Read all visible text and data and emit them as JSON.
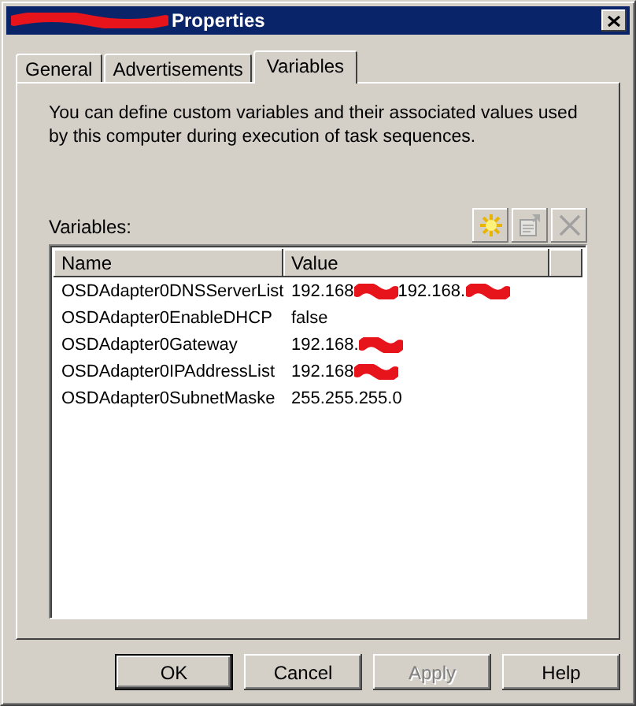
{
  "window": {
    "title": "Properties",
    "title_redacted": true
  },
  "tabs": [
    {
      "label": "General",
      "selected": false
    },
    {
      "label": "Advertisements",
      "selected": false
    },
    {
      "label": "Variables",
      "selected": true
    }
  ],
  "description": "You can define custom variables and their associated values used by this computer during execution of task sequences.",
  "variables_label": "Variables:",
  "toolbar": [
    {
      "kind": "new",
      "disabled": false
    },
    {
      "kind": "properties",
      "disabled": true
    },
    {
      "kind": "delete",
      "disabled": true
    }
  ],
  "table": {
    "columns": [
      "Name",
      "Value"
    ],
    "rows": [
      {
        "name": "OSDAdapter0DNSServerList",
        "value": [
          "192.168",
          "192.168."
        ],
        "redacted": true
      },
      {
        "name": "OSDAdapter0EnableDHCP",
        "value": [
          "false"
        ],
        "redacted": false
      },
      {
        "name": "OSDAdapter0Gateway",
        "value": [
          "192.168."
        ],
        "redacted": true
      },
      {
        "name": "OSDAdapter0IPAddressList",
        "value": [
          "192.168"
        ],
        "redacted": true
      },
      {
        "name": "OSDAdapter0SubnetMaske",
        "value": [
          "255.255.255.0"
        ],
        "redacted": false
      }
    ]
  },
  "buttons": [
    {
      "label": "OK",
      "default": true,
      "disabled": false
    },
    {
      "label": "Cancel",
      "default": false,
      "disabled": false
    },
    {
      "label": "Apply",
      "default": false,
      "disabled": true
    },
    {
      "label": "Help",
      "default": false,
      "disabled": false
    }
  ]
}
